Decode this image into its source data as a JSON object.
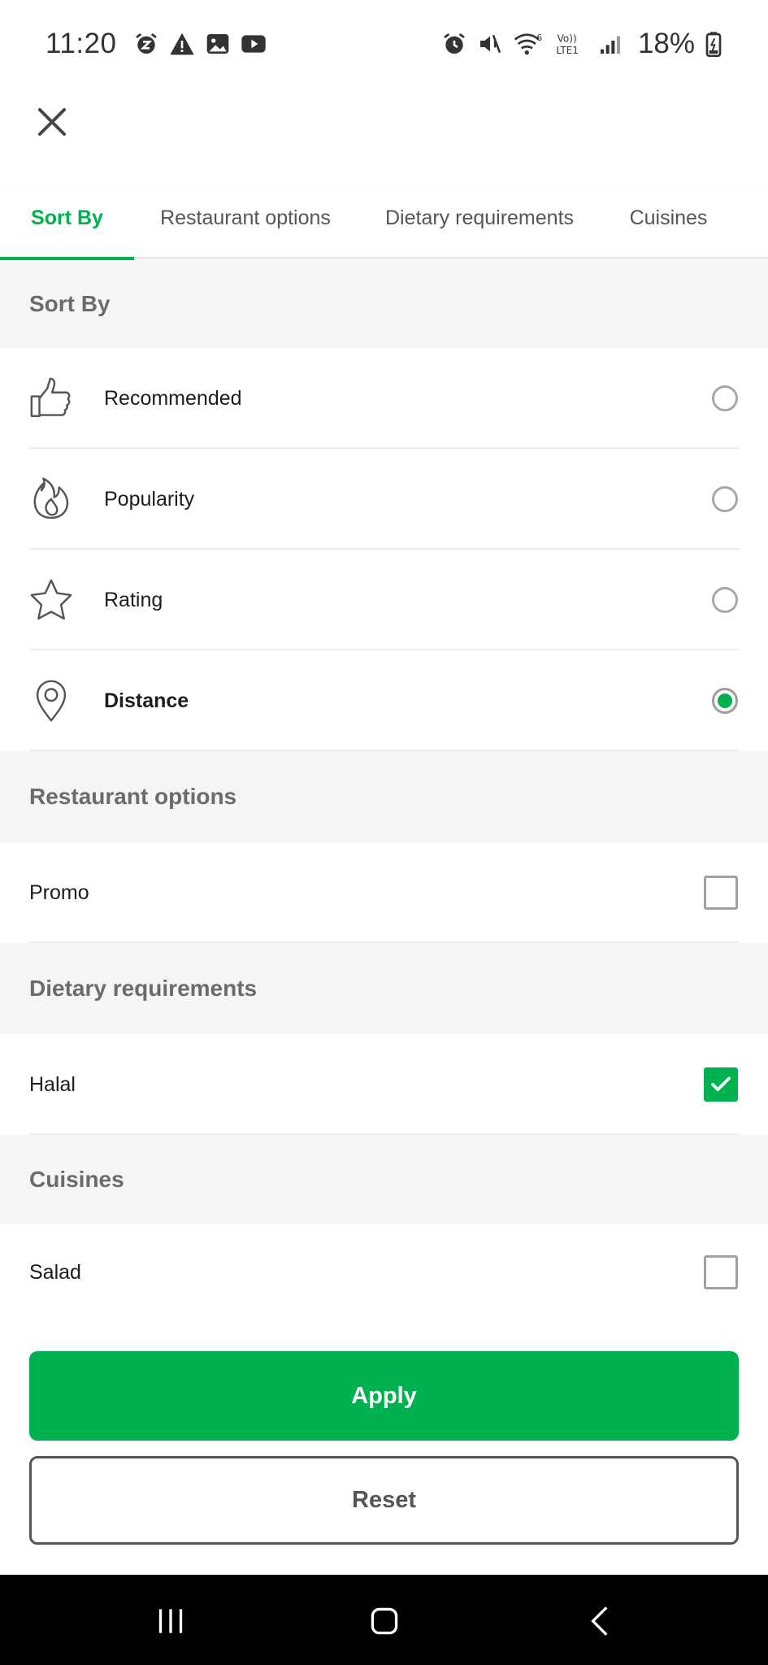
{
  "status_bar": {
    "time": "11:20",
    "battery": "18%",
    "left_icons": [
      "alarm-snooze-icon",
      "warning-icon",
      "gallery-icon",
      "youtube-icon"
    ],
    "right_icons": [
      "alarm-icon",
      "mute-icon",
      "wifi-icon",
      "volte-icon",
      "signal-icon",
      "battery-icon"
    ],
    "volte_label": "Vo))",
    "lte_label": "LTE1",
    "wifi_label": "6"
  },
  "close": {
    "icon": "close-icon"
  },
  "tabs": [
    {
      "label": "Sort By",
      "active": true
    },
    {
      "label": "Restaurant options",
      "active": false
    },
    {
      "label": "Dietary requirements",
      "active": false
    },
    {
      "label": "Cuisines",
      "active": false
    }
  ],
  "sort_by": {
    "header": "Sort By",
    "options": [
      {
        "label": "Recommended",
        "icon": "thumbs-up-icon",
        "selected": false
      },
      {
        "label": "Popularity",
        "icon": "flame-icon",
        "selected": false
      },
      {
        "label": "Rating",
        "icon": "star-icon",
        "selected": false
      },
      {
        "label": "Distance",
        "icon": "location-pin-icon",
        "selected": true
      }
    ]
  },
  "restaurant_options": {
    "header": "Restaurant options",
    "options": [
      {
        "label": "Promo",
        "checked": false
      }
    ]
  },
  "dietary": {
    "header": "Dietary requirements",
    "options": [
      {
        "label": "Halal",
        "checked": true
      }
    ]
  },
  "cuisines": {
    "header": "Cuisines",
    "options": [
      {
        "label": "Salad",
        "checked": false
      }
    ]
  },
  "buttons": {
    "apply": "Apply",
    "reset": "Reset"
  },
  "colors": {
    "accent": "#00b14f",
    "section_bg": "#f5f5f5",
    "text": "#1c1c1c",
    "muted": "#6b6b6b",
    "nav_bar": "#000000"
  }
}
